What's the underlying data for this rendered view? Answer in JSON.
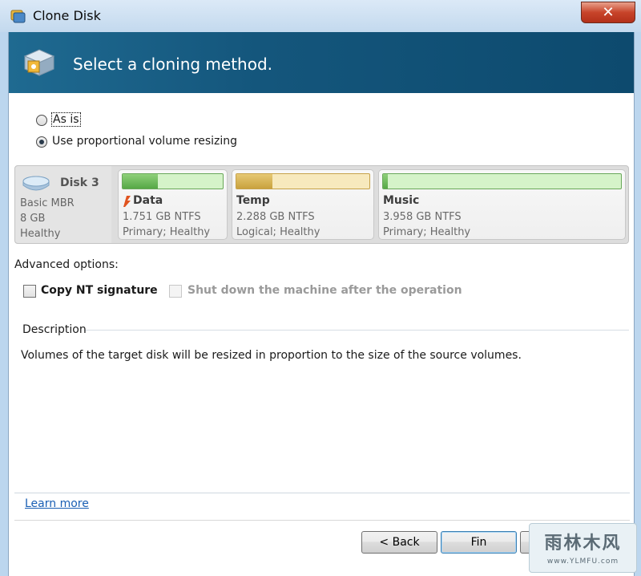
{
  "window": {
    "title": "Clone Disk",
    "close_label": "✕"
  },
  "banner": {
    "heading": "Select a cloning method."
  },
  "method": {
    "options": [
      {
        "label": "As is",
        "selected": false
      },
      {
        "label": "Use proportional volume resizing",
        "selected": true
      }
    ]
  },
  "disk": {
    "name": "Disk 3",
    "type": "Basic MBR",
    "size": "8 GB",
    "status": "Healthy",
    "partitions": [
      {
        "name": "Data",
        "size": "1.751 GB NTFS",
        "status": "Primary; Healthy",
        "used_fraction": 0.35,
        "color": "#56a846"
      },
      {
        "name": "Temp",
        "size": "2.288 GB NTFS",
        "status": "Logical; Healthy",
        "used_fraction": 0.27,
        "color": "#c9a23e"
      },
      {
        "name": "Music",
        "size": "3.958 GB NTFS",
        "status": "Primary; Healthy",
        "used_fraction": 0.02,
        "color": "#56a846"
      }
    ]
  },
  "advanced": {
    "label": "Advanced options:",
    "copy_nt_signature": "Copy NT signature",
    "shutdown_after": "Shut down the machine after the operation"
  },
  "description": {
    "title": "Description",
    "text": "Volumes of the target disk will be resized in proportion to the size of the source volumes."
  },
  "links": {
    "learn_more": "Learn more"
  },
  "buttons": {
    "back": "< Back",
    "finish": "Fin"
  },
  "watermark": {
    "title": "雨林木风",
    "subtitle": "www.YLMFU.com"
  }
}
